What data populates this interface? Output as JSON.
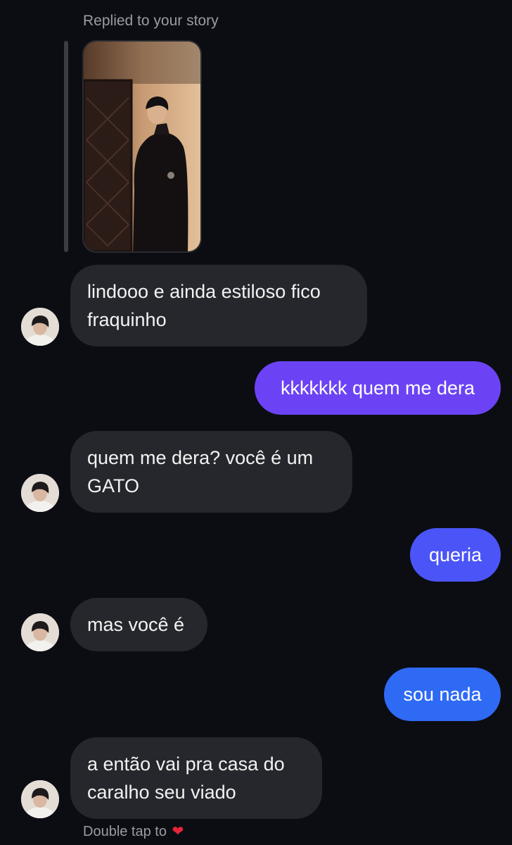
{
  "reply": {
    "label": "Replied to your story"
  },
  "messages": [
    {
      "from": "them",
      "text": "lindooo e ainda estiloso fico fraquinho"
    },
    {
      "from": "me",
      "text": "kkkkkkk quem me dera"
    },
    {
      "from": "them",
      "text": "quem me dera? você é um GATO"
    },
    {
      "from": "me",
      "text": "queria"
    },
    {
      "from": "them",
      "text": "mas você é"
    },
    {
      "from": "me",
      "text": "sou nada"
    },
    {
      "from": "them",
      "text": "a então vai pra casa do caralho seu viado"
    }
  ],
  "footer": {
    "hint": "Double tap to",
    "heart_icon": "heart-icon"
  },
  "colors": {
    "background": "#0c0d12",
    "incoming_bubble": "#25272c",
    "outgoing_gradient": [
      "#7a3ef2",
      "#3a5cf6",
      "#2f6ff4"
    ],
    "meta_text": "#9a9ca3",
    "heart": "#e8243a"
  }
}
